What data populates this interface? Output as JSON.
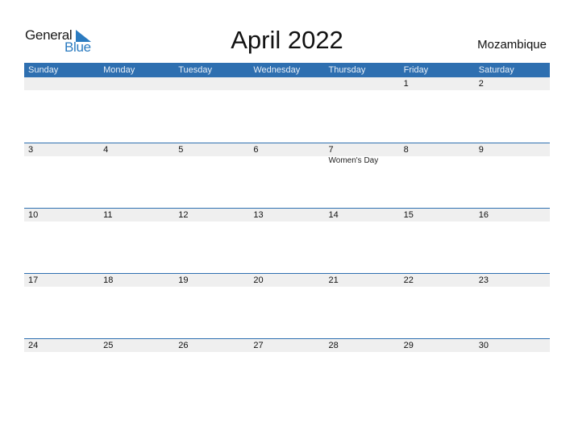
{
  "logo": {
    "word1": "General",
    "word2": "Blue",
    "brand_color": "#2b7bc0"
  },
  "title": "April 2022",
  "country": "Mozambique",
  "colors": {
    "header_bg": "#2e6fb0",
    "date_band_bg": "#efefef"
  },
  "weekdays": [
    "Sunday",
    "Monday",
    "Tuesday",
    "Wednesday",
    "Thursday",
    "Friday",
    "Saturday"
  ],
  "weeks": [
    {
      "days": [
        "",
        "",
        "",
        "",
        "",
        "1",
        "2"
      ],
      "events": [
        "",
        "",
        "",
        "",
        "",
        "",
        ""
      ]
    },
    {
      "days": [
        "3",
        "4",
        "5",
        "6",
        "7",
        "8",
        "9"
      ],
      "events": [
        "",
        "",
        "",
        "",
        "Women's Day",
        "",
        ""
      ]
    },
    {
      "days": [
        "10",
        "11",
        "12",
        "13",
        "14",
        "15",
        "16"
      ],
      "events": [
        "",
        "",
        "",
        "",
        "",
        "",
        ""
      ]
    },
    {
      "days": [
        "17",
        "18",
        "19",
        "20",
        "21",
        "22",
        "23"
      ],
      "events": [
        "",
        "",
        "",
        "",
        "",
        "",
        ""
      ]
    },
    {
      "days": [
        "24",
        "25",
        "26",
        "27",
        "28",
        "29",
        "30"
      ],
      "events": [
        "",
        "",
        "",
        "",
        "",
        "",
        ""
      ]
    }
  ]
}
